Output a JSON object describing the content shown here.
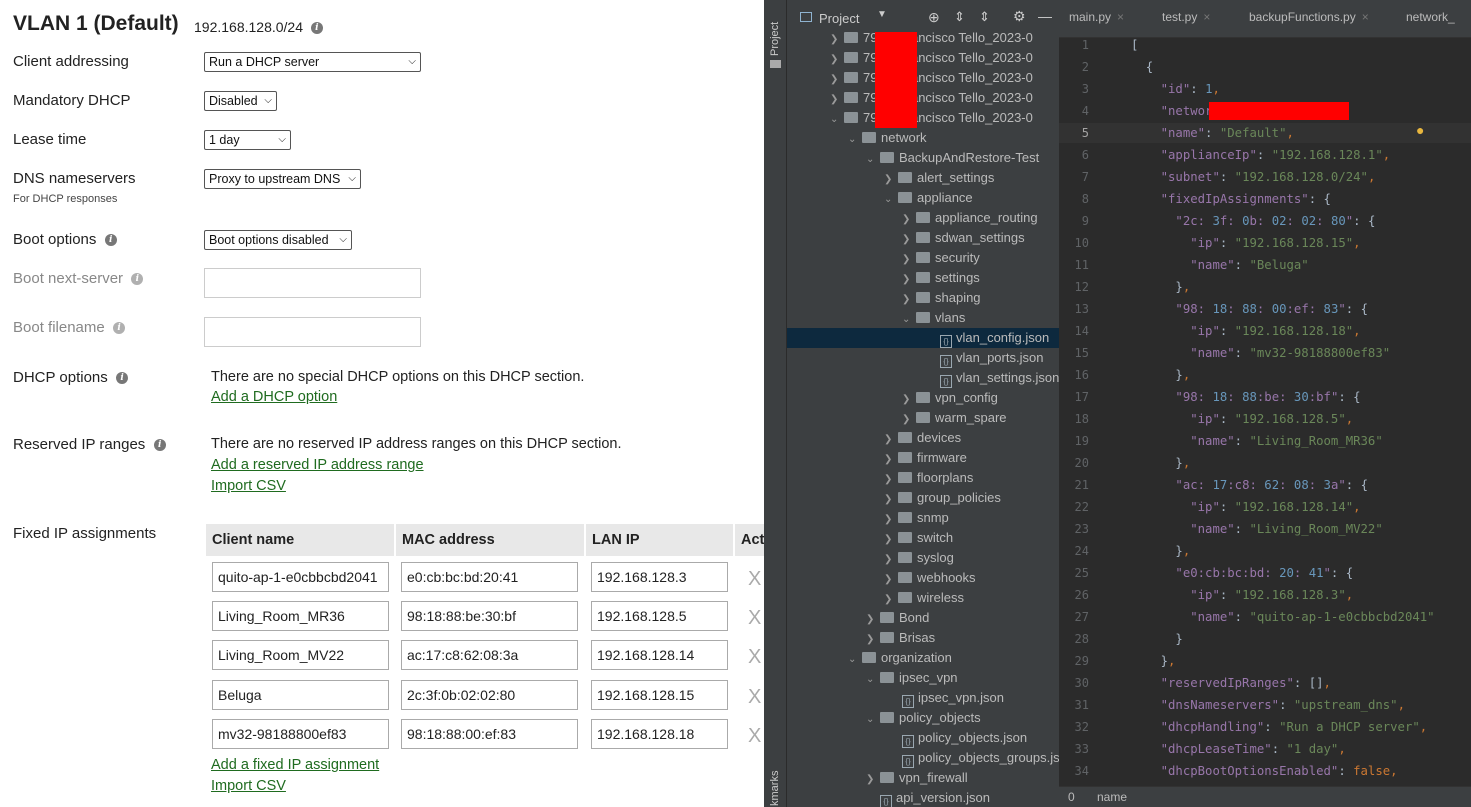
{
  "vlan": {
    "title": "VLAN 1 (Default)",
    "subnet": "192.168.128.0/24"
  },
  "form": {
    "client_addressing": {
      "label": "Client addressing",
      "value": "Run a DHCP server"
    },
    "mandatory_dhcp": {
      "label": "Mandatory DHCP",
      "value": "Disabled"
    },
    "lease_time": {
      "label": "Lease time",
      "value": "1 day"
    },
    "dns": {
      "label": "DNS nameservers",
      "sublabel": "For DHCP responses",
      "value": "Proxy to upstream DNS"
    },
    "boot_options": {
      "label": "Boot options",
      "value": "Boot options disabled"
    },
    "boot_next_server": {
      "label": "Boot next-server",
      "value": ""
    },
    "boot_filename": {
      "label": "Boot filename",
      "value": ""
    },
    "dhcp_options": {
      "label": "DHCP options",
      "text": "There are no special DHCP options on this DHCP section.",
      "link": "Add a DHCP option"
    },
    "reserved": {
      "label": "Reserved IP ranges",
      "text": "There are no reserved IP address ranges on this DHCP section.",
      "link": "Add a reserved IP address range",
      "import": "Import CSV"
    },
    "fixed": {
      "label": "Fixed IP assignments",
      "headers": [
        "Client name",
        "MAC address",
        "LAN IP",
        "Act"
      ],
      "rows": [
        {
          "name": "quito-ap-1-e0cbbcbd2041",
          "mac": "e0:cb:bc:bd:20:41",
          "ip": "192.168.128.3"
        },
        {
          "name": "Living_Room_MR36",
          "mac": "98:18:88:be:30:bf",
          "ip": "192.168.128.5"
        },
        {
          "name": "Living_Room_MV22",
          "mac": "ac:17:c8:62:08:3a",
          "ip": "192.168.128.14"
        },
        {
          "name": "Beluga",
          "mac": "2c:3f:0b:02:02:80",
          "ip": "192.168.128.15"
        },
        {
          "name": "mv32-98188800ef83",
          "mac": "98:18:88:00:ef:83",
          "ip": "192.168.128.18"
        }
      ],
      "delete_glyph": "X",
      "link": "Add a fixed IP assignment",
      "import": "Import CSV"
    }
  },
  "ide": {
    "stripe_project": "Project",
    "stripe_bookmarks": "kmarks",
    "project_label": "Project",
    "tabs": [
      "main.py",
      "test.py",
      "backupFunctions.py",
      "network_"
    ],
    "tree": [
      {
        "label": "79",
        "suffix": "_Francisco Tello_2023-0"
      },
      {
        "label": "79",
        "suffix": "_Francisco Tello_2023-0"
      },
      {
        "label": "79",
        "suffix": "_Francisco Tello_2023-0"
      },
      {
        "label": "79",
        "suffix": "_Francisco Tello_2023-0"
      },
      {
        "label": "79",
        "suffix": "_Francisco Tello_2023-0"
      },
      {
        "label": "network"
      },
      {
        "label": "BackupAndRestore-Test"
      },
      {
        "label": "alert_settings"
      },
      {
        "label": "appliance"
      },
      {
        "label": "appliance_routing"
      },
      {
        "label": "sdwan_settings"
      },
      {
        "label": "security"
      },
      {
        "label": "settings"
      },
      {
        "label": "shaping"
      },
      {
        "label": "vlans"
      },
      {
        "label": "vlan_config.json"
      },
      {
        "label": "vlan_ports.json"
      },
      {
        "label": "vlan_settings.json"
      },
      {
        "label": "vpn_config"
      },
      {
        "label": "warm_spare"
      },
      {
        "label": "devices"
      },
      {
        "label": "firmware"
      },
      {
        "label": "floorplans"
      },
      {
        "label": "group_policies"
      },
      {
        "label": "snmp"
      },
      {
        "label": "switch"
      },
      {
        "label": "syslog"
      },
      {
        "label": "webhooks"
      },
      {
        "label": "wireless"
      },
      {
        "label": "Bond"
      },
      {
        "label": "Brisas"
      },
      {
        "label": "organization"
      },
      {
        "label": "ipsec_vpn"
      },
      {
        "label": "ipsec_vpn.json"
      },
      {
        "label": "policy_objects"
      },
      {
        "label": "policy_objects.json"
      },
      {
        "label": "policy_objects_groups.json"
      },
      {
        "label": "vpn_firewall"
      },
      {
        "label": "api_version.json"
      }
    ],
    "line_numbers": [
      "1",
      "2",
      "3",
      "4",
      "5",
      "6",
      "7",
      "8",
      "9",
      "10",
      "11",
      "12",
      "13",
      "14",
      "15",
      "16",
      "17",
      "18",
      "19",
      "20",
      "21",
      "22",
      "23",
      "24",
      "25",
      "26",
      "27",
      "28",
      "29",
      "30",
      "31",
      "32",
      "33",
      "34"
    ],
    "code": [
      "[",
      "  {",
      "    \"id\": 1,",
      "    \"networkId\": \"L_82",
      "    \"name\": \"Default\",",
      "    \"applianceIp\": \"192.168.128.1\",",
      "    \"subnet\": \"192.168.128.0/24\",",
      "    \"fixedIpAssignments\": {",
      "      \"2c:3f:0b:02:02:80\": {",
      "        \"ip\": \"192.168.128.15\",",
      "        \"name\": \"Beluga\"",
      "      },",
      "      \"98:18:88:00:ef:83\": {",
      "        \"ip\": \"192.168.128.18\",",
      "        \"name\": \"mv32-98188800ef83\"",
      "      },",
      "      \"98:18:88:be:30:bf\": {",
      "        \"ip\": \"192.168.128.5\",",
      "        \"name\": \"Living_Room_MR36\"",
      "      },",
      "      \"ac:17:c8:62:08:3a\": {",
      "        \"ip\": \"192.168.128.14\",",
      "        \"name\": \"Living_Room_MV22\"",
      "      },",
      "      \"e0:cb:bc:bd:20:41\": {",
      "        \"ip\": \"192.168.128.3\",",
      "        \"name\": \"quito-ap-1-e0cbbcbd2041\"",
      "      }",
      "    },",
      "    \"reservedIpRanges\": [],",
      "    \"dnsNameservers\": \"upstream_dns\",",
      "    \"dhcpHandling\": \"Run a DHCP server\",",
      "    \"dhcpLeaseTime\": \"1 day\",",
      "    \"dhcpBootOptionsEnabled\": false,"
    ],
    "status_left": "0",
    "status_path": "name",
    "colors": {
      "key": "#9876aa",
      "string": "#6a8759",
      "number": "#6897bb",
      "keyword": "#cc7832",
      "selection": "#0d293e"
    }
  }
}
